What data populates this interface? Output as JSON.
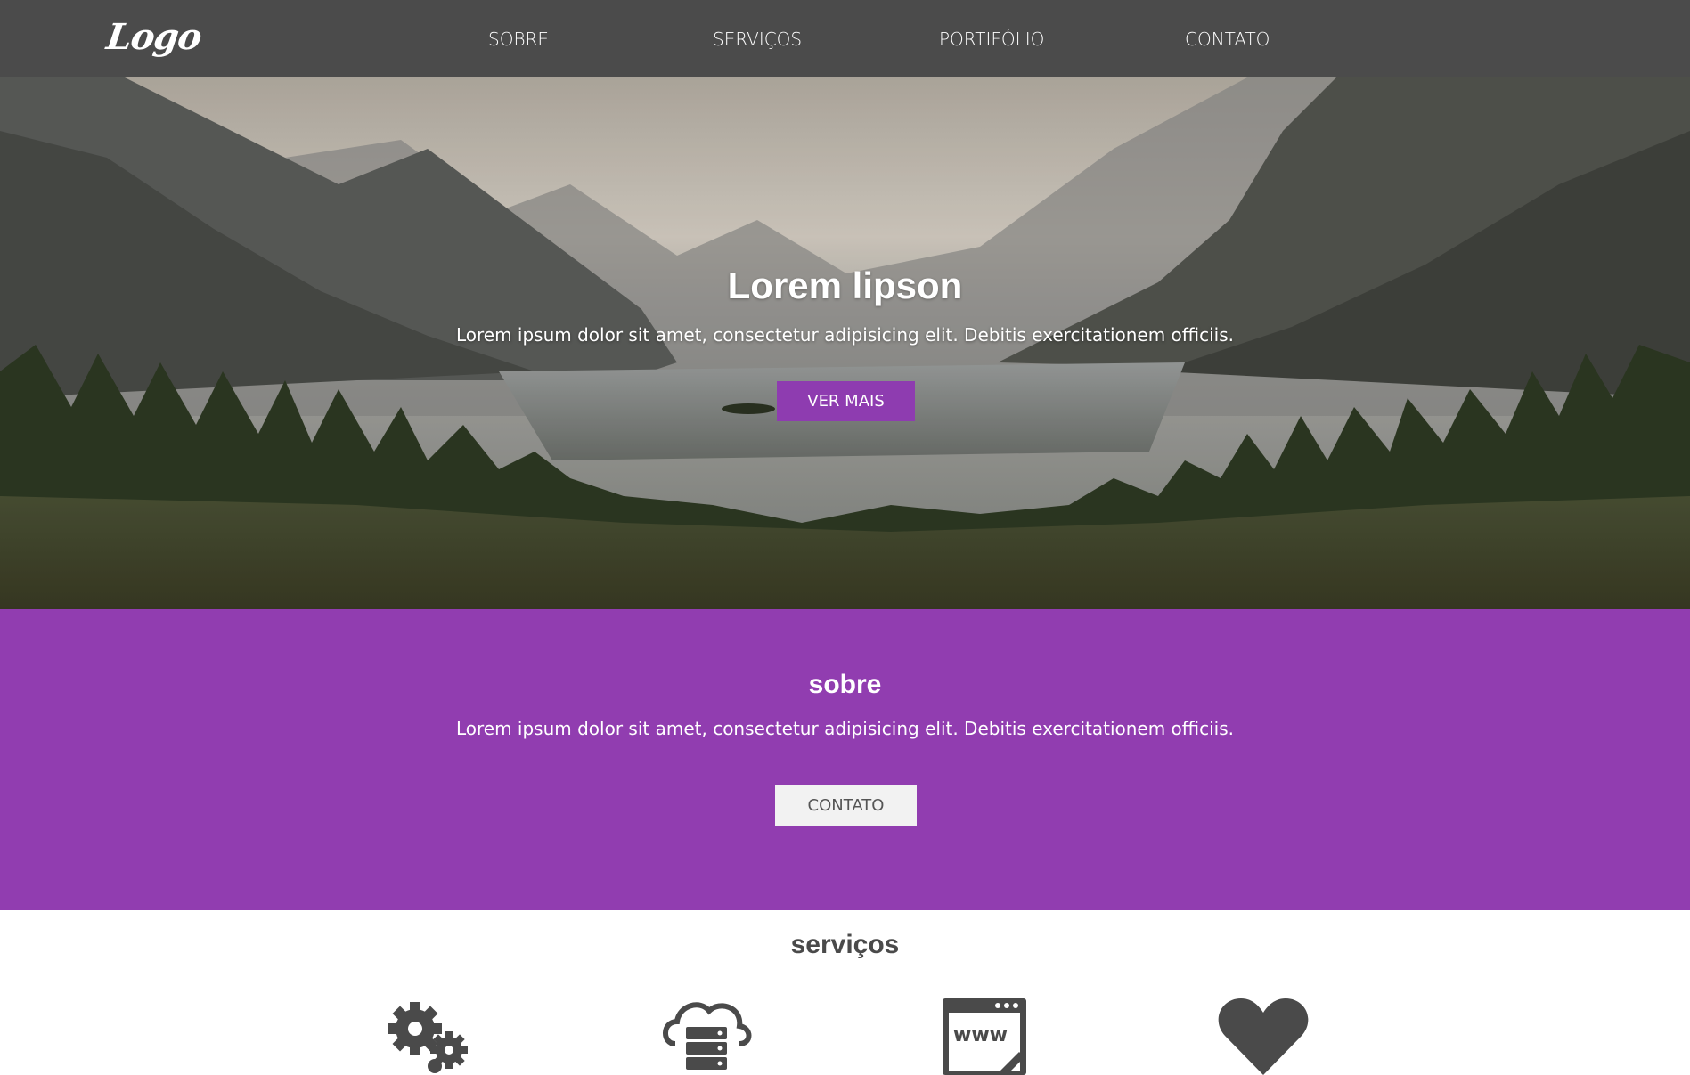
{
  "header": {
    "logo": "Logo",
    "nav": [
      "SOBRE",
      "SERVIÇOS",
      "PORTIFÓLIO",
      "CONTATO"
    ]
  },
  "hero": {
    "title": "Lorem lipson",
    "subtitle": "Lorem ipsum dolor sit amet, consectetur adipisicing elit. Debitis exercitationem officiis.",
    "button": "VER MAIS"
  },
  "sobre": {
    "title": "sobre",
    "text": "Lorem ipsum dolor sit amet, consectetur adipisicing elit. Debitis exercitationem officiis.",
    "button": "CONTATO"
  },
  "servicos": {
    "title": "serviços",
    "icons": [
      "gears-icon",
      "cloud-server-icon",
      "www-browser-icon",
      "heart-icon"
    ]
  },
  "colors": {
    "header": "#4b4b4b",
    "accent": "#913db0",
    "button_accent": "#8e3cb0",
    "icon": "#4a4a4a"
  }
}
